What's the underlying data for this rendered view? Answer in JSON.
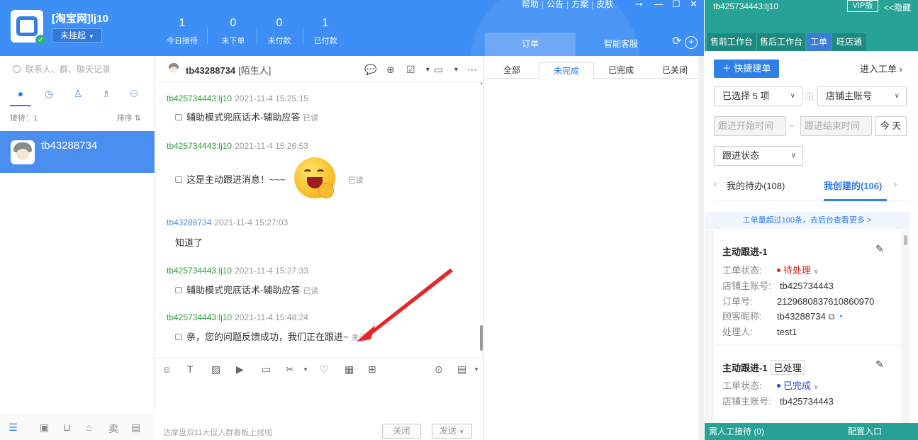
{
  "header": {
    "account_name": "[淘宝网]lj10",
    "account_status": "未挂起",
    "stats": [
      {
        "value": "1",
        "label": "今日接待"
      },
      {
        "value": "0",
        "label": "未下单"
      },
      {
        "value": "0",
        "label": "未付款"
      },
      {
        "value": "1",
        "label": "已付款"
      }
    ],
    "menu": [
      "帮助",
      "公告",
      "方案",
      "皮肤"
    ],
    "right_tabs": [
      "订单",
      "智能客服"
    ]
  },
  "left": {
    "search_placeholder": "联系人、群、聊天记录",
    "reception_label": "接待：1",
    "sort_label": "排序",
    "conversation_name": "tb43288734"
  },
  "chat": {
    "title_name": "tb43288734",
    "title_tag": "[陌生人]",
    "messages": [
      {
        "sender": "tb425734443:lj10",
        "time": "2021-11-4 15:25:15",
        "text": "辅助模式兜底话术-辅助应答",
        "status": "已读"
      },
      {
        "sender": "tb425734443:lj10",
        "time": "2021-11-4 15:26:53",
        "text": "这是主动跟进消息！~~~",
        "status": "已读"
      },
      {
        "sender": "tb43288734",
        "time": "2021-11-4 15:27:03",
        "text": "知道了",
        "status": ""
      },
      {
        "sender": "tb425734443:lj10",
        "time": "2021-11-4 15:27:33",
        "text": "辅助模式兜底话术-辅助应答",
        "status": "已读"
      },
      {
        "sender": "tb425734443:lj10",
        "time": "2021-11-4 15:48:24",
        "text": "亲，您的问题反馈成功，我们正在跟进~",
        "status": "未读"
      }
    ],
    "footer_tip": "达摩盘双11大促人群看板上线啦",
    "close_label": "关闭",
    "send_label": "发送"
  },
  "orders": {
    "tabs": [
      "全部",
      "未完成",
      "已完成",
      "已关闭"
    ],
    "active_tab": "未完成"
  },
  "workorder": {
    "account": "tb425734443:lj10",
    "vip_label": "VIP版",
    "hide_label": "<<隐藏",
    "tabs": [
      "售前工作台",
      "售后工作台",
      "工单",
      "旺店通"
    ],
    "quick_create": "快捷建单",
    "enter_label": "进入工单",
    "selected_label": "已选择 5 项",
    "shop_account_label": "店铺主账号",
    "start_time_placeholder": "跟进开始时间",
    "end_time_placeholder": "跟进结束时间",
    "time_sep": "~",
    "today_label": "今 天",
    "status_filter_label": "跟进状态",
    "my_todo": "我的待办(108)",
    "my_created": "我创建的(106)",
    "notice": "工单量超过100条，去后台查看更多 >",
    "field_labels": {
      "status": "工单状态:",
      "shop": "店铺主账号:",
      "order_no": "订单号:",
      "nick": "顾客昵称:",
      "handler": "处理人:"
    },
    "cards": [
      {
        "title": "主动跟进-1",
        "status": "待处理",
        "status_color": "#e02020",
        "shop": "tb425734443",
        "order_no": "2129680837610860970",
        "nick": "tb43288734",
        "handler": "test1"
      },
      {
        "title": "主动跟进-1",
        "tag": "已处理",
        "status": "已完成",
        "status_color": "#1e40d8",
        "shop": "tb425734443"
      }
    ],
    "footer_left": "需人工接待 (0)",
    "footer_right": "配置入口"
  }
}
